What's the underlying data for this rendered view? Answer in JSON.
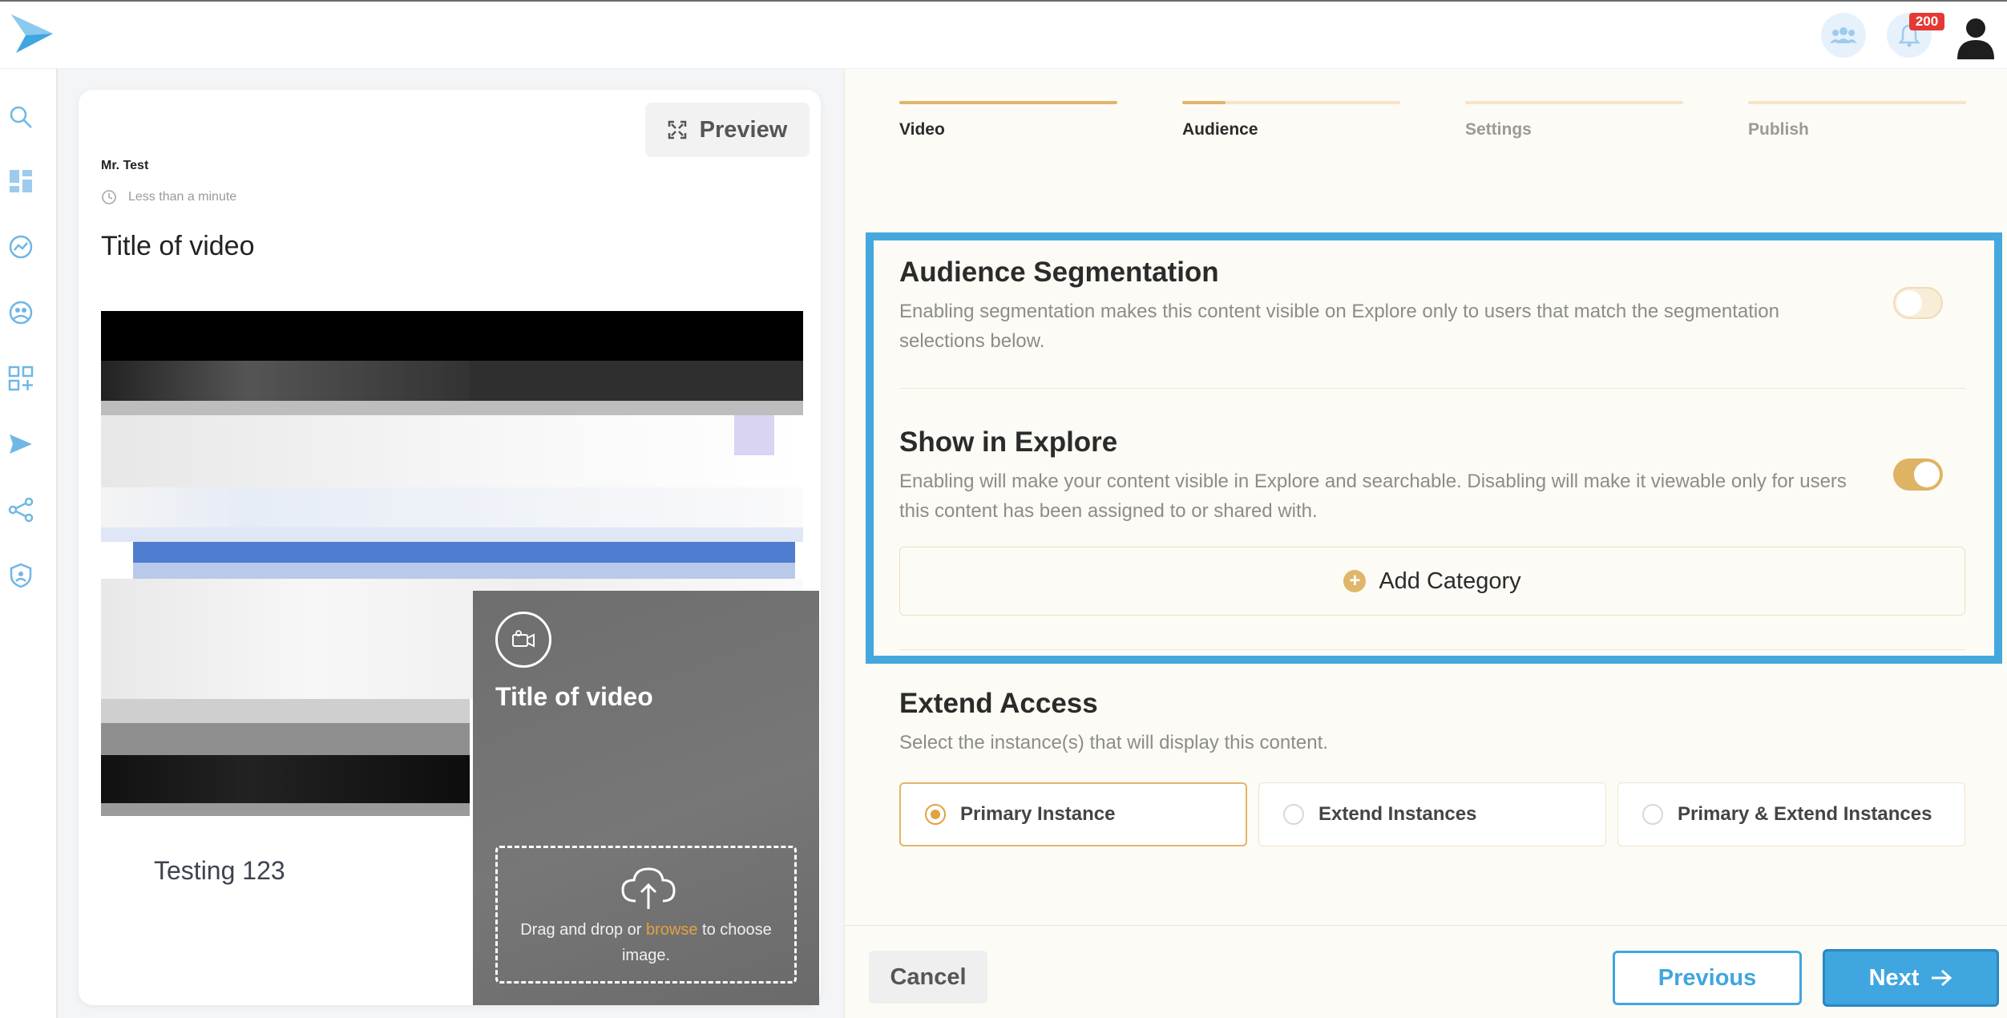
{
  "header": {
    "logo_icon": "send-arrow-logo",
    "notification_count": "200",
    "icons": [
      "group-icon",
      "bell-icon",
      "user-avatar-icon"
    ]
  },
  "sidebar": {
    "items": [
      {
        "name": "search-icon"
      },
      {
        "name": "dashboard-icon"
      },
      {
        "name": "analytics-icon"
      },
      {
        "name": "people-icon"
      },
      {
        "name": "add-widget-icon"
      },
      {
        "name": "send-icon"
      },
      {
        "name": "share-icon"
      },
      {
        "name": "shield-icon"
      }
    ]
  },
  "preview": {
    "button_label": "Preview",
    "author": "Mr. Test",
    "duration": "Less than a minute",
    "title": "Title of video",
    "description": "Testing 123",
    "upload": {
      "title": "Title of video",
      "drop_text_before": "Drag and drop or ",
      "browse_label": "browse",
      "drop_text_after": " to choose image."
    }
  },
  "steps": [
    {
      "label": "Video",
      "progress": 1.0
    },
    {
      "label": "Audience",
      "progress": 0.2
    },
    {
      "label": "Settings",
      "progress": 0
    },
    {
      "label": "Publish",
      "progress": 0
    }
  ],
  "audience_segmentation": {
    "title": "Audience Segmentation",
    "description": "Enabling segmentation makes this content visible on Explore only to users that match the segmentation selections below.",
    "enabled": false
  },
  "show_in_explore": {
    "title": "Show in Explore",
    "description": "Enabling will make your content visible in Explore and searchable. Disabling will make it viewable only for users this content has been assigned to or shared with.",
    "enabled": true,
    "add_category_label": "Add Category"
  },
  "extend_access": {
    "title": "Extend Access",
    "description": "Select the instance(s) that will display this content.",
    "options": [
      {
        "label": "Primary Instance",
        "selected": true
      },
      {
        "label": "Extend Instances",
        "selected": false
      },
      {
        "label": "Primary & Extend Instances",
        "selected": false
      }
    ]
  },
  "footer": {
    "cancel_label": "Cancel",
    "previous_label": "Previous",
    "next_label": "Next"
  },
  "colors": {
    "accent_blue": "#3fa6e0",
    "accent_gold": "#e0b66a",
    "badge_red": "#e53935"
  }
}
